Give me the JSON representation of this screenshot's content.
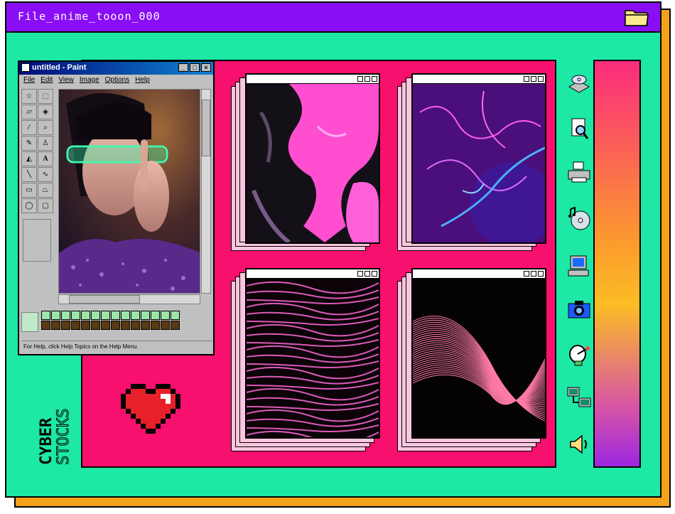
{
  "window": {
    "title": "File_anime_tooon_000"
  },
  "paint": {
    "title": "untitled - Paint",
    "menu": [
      "File",
      "Edit",
      "View",
      "Image",
      "Options",
      "Help"
    ],
    "status": "For Help, click Help Topics on the Help Menu."
  },
  "brand": {
    "line1": "CYBER",
    "line2": "STOCKS"
  },
  "icons": [
    "folder-icon",
    "cd-drive-icon",
    "search-document-icon",
    "printer-icon",
    "music-cd-icon",
    "computer-icon",
    "camera-icon",
    "satellite-dish-icon",
    "network-icon",
    "speaker-icon"
  ],
  "colors": {
    "accent": "#8a0ef5",
    "background": "#1de8a6",
    "panel": "#f8106e",
    "shadow": "#f4a11c"
  }
}
